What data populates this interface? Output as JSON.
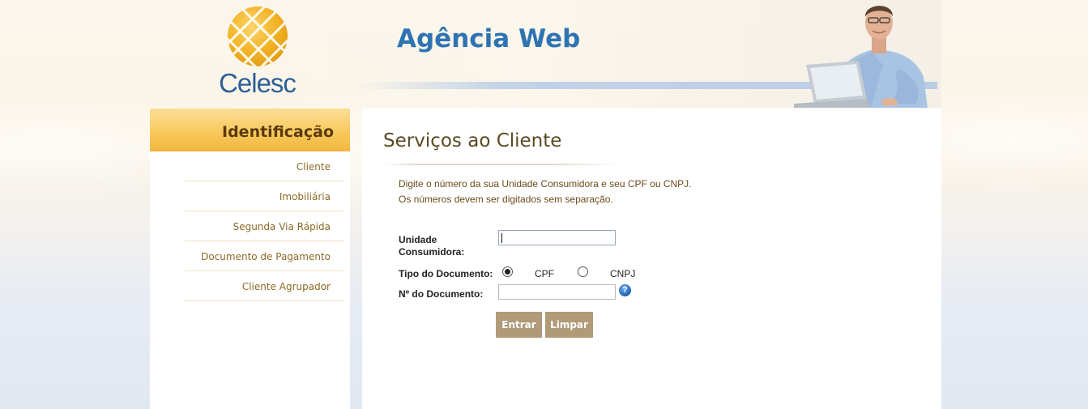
{
  "header": {
    "brand": "Celesc",
    "app_title": "Agência Web"
  },
  "sidebar": {
    "heading": "Identificação",
    "items": [
      {
        "label": "Cliente"
      },
      {
        "label": "Imobiliária"
      },
      {
        "label": "Segunda Via Rápida"
      },
      {
        "label": "Documento de Pagamento"
      },
      {
        "label": "Cliente Agrupador"
      }
    ]
  },
  "main": {
    "title": "Serviços ao Cliente",
    "intro_line1": "Digite o número da sua Unidade Consumidora e seu CPF ou CNPJ.",
    "intro_line2": "Os números devem ser digitados sem separação.",
    "form": {
      "unidade_label_1": "Unidade",
      "unidade_label_2": "Consumidora:",
      "unidade_value": "",
      "tipo_label": "Tipo do Documento:",
      "option_cpf": "CPF",
      "option_cnpj": "CNPJ",
      "selected_option": "CPF",
      "documento_label": "Nº do Documento:",
      "documento_value": "",
      "help_icon": "question-icon",
      "submit_label": "Entrar",
      "clear_label": "Limpar"
    }
  },
  "colors": {
    "accent_blue": "#2e73b2",
    "sidebar_header": "#f8c95e",
    "button": "#b09a78",
    "title": "#5a4a22",
    "menu_text": "#8a6a25"
  }
}
